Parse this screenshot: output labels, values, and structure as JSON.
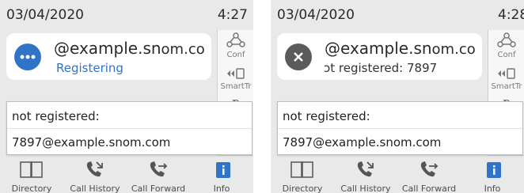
{
  "screens": [
    {
      "date": "03/04/2020",
      "time": "4:27",
      "identity": "@example.sn",
      "identity_tail": "om.co",
      "status": "Registering",
      "side": [
        "Conf",
        "SmartTr"
      ],
      "popup": {
        "line1": "not registered:",
        "line2": "7897@example.snom.com"
      },
      "softkeys": [
        "Directory",
        "Call History",
        "Call Forward",
        "Info"
      ]
    },
    {
      "date": "03/04/2020",
      "time": "4:28",
      "identity": "@example.sn",
      "identity_tail": "om.co",
      "status": "ɔt registered: 7897",
      "side": [
        "Conf",
        "SmartTr"
      ],
      "popup": {
        "line1": "not registered:",
        "line2": "7897@example.snom.com"
      },
      "softkeys": [
        "Directory",
        "Call History",
        "Call Forward",
        "Info"
      ]
    }
  ],
  "icons": {
    "status_left": "ellipsis-icon",
    "status_right": "close-icon",
    "conf": "conference-icon",
    "smarttransfer": "smart-transfer-icon",
    "directory": "book-icon",
    "history": "call-history-icon",
    "forward": "call-forward-icon",
    "info": "info-icon"
  },
  "colors": {
    "accent": "#2f74c7",
    "screen_bg": "#e9e9ea"
  }
}
